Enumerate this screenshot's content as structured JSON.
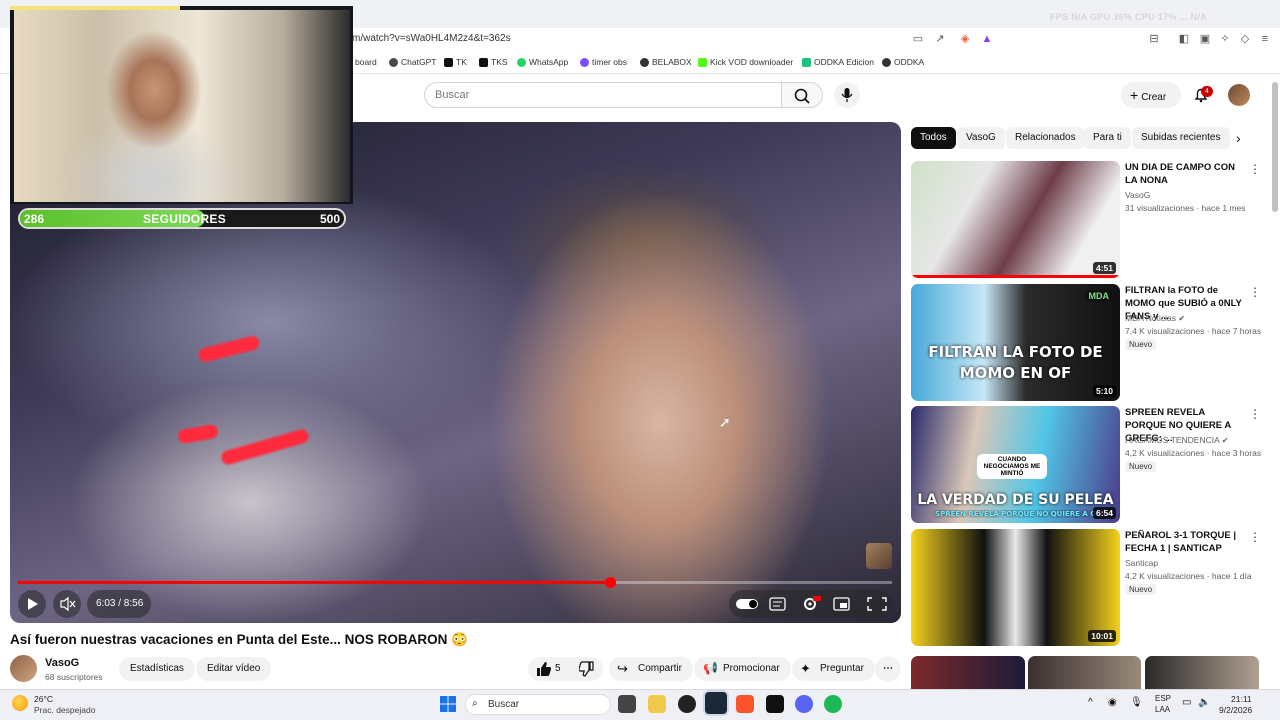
{
  "browser": {
    "url": "m/watch?v=sWa0HL4M2z4&t=362s",
    "bookmarks": [
      {
        "label": "board",
        "color": "#4a4a4a"
      },
      {
        "label": "ChatGPT",
        "color": "#4a4a4a"
      },
      {
        "label": "TK",
        "color": "#111111"
      },
      {
        "label": "TKS",
        "color": "#111111"
      },
      {
        "label": "WhatsApp",
        "color": "#25d366"
      },
      {
        "label": "timer obs",
        "color": "#7c4dff"
      },
      {
        "label": "BELABOX",
        "color": "#333333"
      },
      {
        "label": "Kick VOD downloader",
        "color": "#53fc18"
      },
      {
        "label": "ODDKA Edicion",
        "color": "#19c37d"
      },
      {
        "label": "ODDKA",
        "color": "#333333"
      }
    ],
    "perf_overlay": "FPS N/A   GPU 36%   CPU 17%   ...   N/A"
  },
  "youtube": {
    "search_placeholder": "Buscar",
    "create_label": "Crear",
    "notifications_count": "4"
  },
  "overlay": {
    "followers_current": "286",
    "followers_label": "SEGUIDORES",
    "followers_goal": "500",
    "followers_progress": 0.572
  },
  "player": {
    "time": "6:03 / 8:56",
    "progress": 0.677
  },
  "video": {
    "title": "Así fueron nuestras vacaciones en Punta del Este... NOS ROBARON 😳",
    "channel_name": "VasoG",
    "channel_subs": "68 suscriptores",
    "stats_label": "Estadísticas",
    "edit_label": "Editar vídeo",
    "like_count": "5",
    "share_label": "Compartir",
    "promote_label": "Promocionar",
    "ask_label": "Preguntar"
  },
  "chips": [
    "Todos",
    "VasoG",
    "Relacionados",
    "Para ti",
    "Subidas recientes"
  ],
  "recommendations": [
    {
      "title": "UN DIA DE CAMPO CON LA NONA",
      "channel": "VasoG",
      "meta": "31 visualizaciones · hace 1 mes",
      "badge": "",
      "duration": "4:51",
      "verified": false
    },
    {
      "title": "FILTRAN la FOTO de MOMO que SUBIÓ a 0NLY FANS y ...",
      "channel": "MDA Noticias",
      "meta": "7,4 K visualizaciones · hace 7 horas",
      "badge": "Nuevo",
      "duration": "5:10",
      "verified": true,
      "thumb_text": "FILTRAN LA FOTO DE MOMO EN OF",
      "thumb_tag": "MDA"
    },
    {
      "title": "SPREEN REVELA PORQUE NO QUIERE A GREFG: ...",
      "channel": "HAGAMOS TENDENCIA",
      "meta": "4,2 K visualizaciones · hace 3 horas",
      "badge": "Nuevo",
      "duration": "6:54",
      "verified": true,
      "thumb_text": "LA VERDAD DE SU PELEA",
      "thumb_sub": "SPREEN REVELA PORQUE NO QUIERE A G",
      "thumb_bubble": "CUANDO NEGOCIAMOS ME MINTIÓ"
    },
    {
      "title": "PEÑAROL 3-1 TORQUE | FECHA 1 | SANTICAP",
      "channel": "Santicap",
      "meta": "4,2 K visualizaciones · hace 1 día",
      "badge": "Nuevo",
      "duration": "10:01",
      "verified": false
    }
  ],
  "taskbar": {
    "temp": "26°C",
    "weather": "Prac. despejado",
    "search": "Buscar",
    "lang1": "ESP",
    "lang2": "LAA",
    "time": "21:11",
    "date": "9/2/2026"
  }
}
